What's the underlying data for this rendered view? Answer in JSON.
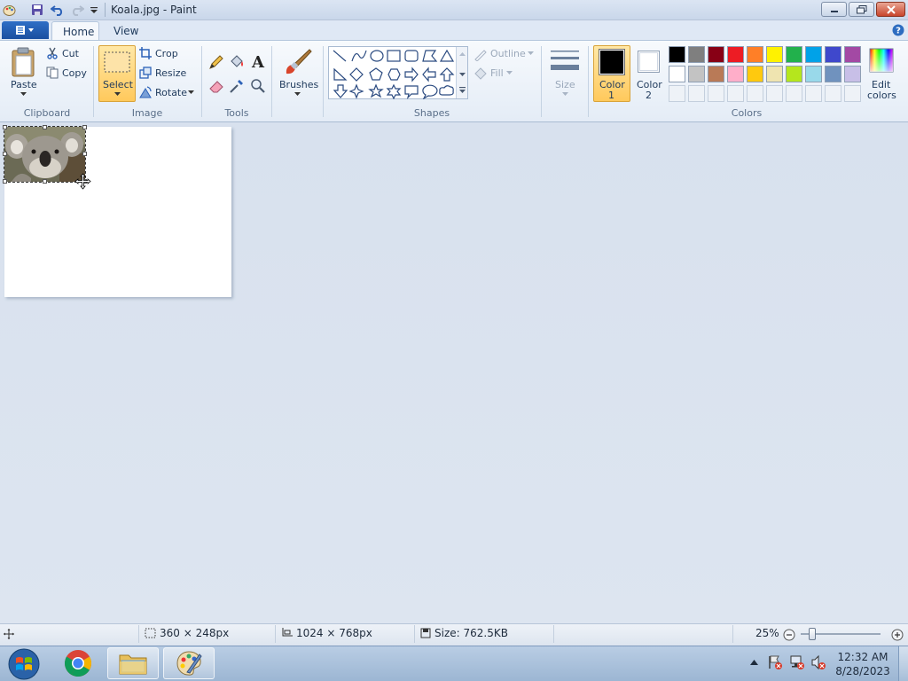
{
  "window": {
    "title": "Koala.jpg - Paint"
  },
  "tabs": {
    "file_icon": "paint-menu-icon",
    "home": "Home",
    "view": "View"
  },
  "clipboard": {
    "paste": "Paste",
    "cut": "Cut",
    "copy": "Copy",
    "group": "Clipboard"
  },
  "image": {
    "select": "Select",
    "crop": "Crop",
    "resize": "Resize",
    "rotate": "Rotate",
    "group": "Image"
  },
  "tools": {
    "group": "Tools",
    "text_glyph": "A"
  },
  "brushes": {
    "label": "Brushes"
  },
  "shapes": {
    "outline": "Outline",
    "fill": "Fill",
    "group": "Shapes"
  },
  "size": {
    "label": "Size"
  },
  "colors": {
    "color1_label": "Color",
    "color1_num": "1",
    "color2_label": "Color",
    "color2_num": "2",
    "edit_label": "Edit",
    "edit_label2": "colors",
    "group": "Colors",
    "color1": "#000000",
    "color2": "#ffffff",
    "palette_row1": [
      "#000000",
      "#7f7f7f",
      "#880015",
      "#ed1c24",
      "#ff7f27",
      "#fff200",
      "#22b14c",
      "#00a2e8",
      "#3f48cc",
      "#a349a4"
    ],
    "palette_row2": [
      "#ffffff",
      "#c3c3c3",
      "#b97a57",
      "#ffaec9",
      "#ffc90e",
      "#efe4b0",
      "#b5e61d",
      "#99d9ea",
      "#7092be",
      "#c8bfe7"
    ]
  },
  "status": {
    "selection_size": "360 × 248px",
    "image_size": "1024 × 768px",
    "file_size": "Size: 762.5KB",
    "zoom": "25%"
  },
  "taskbar": {
    "time": "12:32 AM",
    "date": "8/28/2023"
  }
}
